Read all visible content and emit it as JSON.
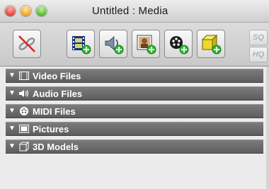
{
  "window": {
    "title": "Untitled : Media"
  },
  "toolbar": {
    "buttons": [
      {
        "name": "remove-media",
        "icon": "broken-link-icon"
      },
      {
        "name": "add-video",
        "icon": "film-add-icon"
      },
      {
        "name": "add-audio",
        "icon": "speaker-add-icon"
      },
      {
        "name": "add-picture",
        "icon": "picture-add-icon"
      },
      {
        "name": "add-midi",
        "icon": "midi-add-icon"
      },
      {
        "name": "add-3d-model",
        "icon": "cube-add-icon"
      }
    ],
    "quality": {
      "sq_label": "SQ",
      "hq_label": "HQ"
    }
  },
  "groups": [
    {
      "label": "Video Files",
      "icon": "film-icon"
    },
    {
      "label": "Audio Files",
      "icon": "speaker-icon"
    },
    {
      "label": "MIDI Files",
      "icon": "midi-icon"
    },
    {
      "label": "Pictures",
      "icon": "picture-icon"
    },
    {
      "label": "3D Models",
      "icon": "cube-icon"
    }
  ],
  "colors": {
    "group_header": "#6a6a6a",
    "add_badge": "#2fb52f"
  }
}
